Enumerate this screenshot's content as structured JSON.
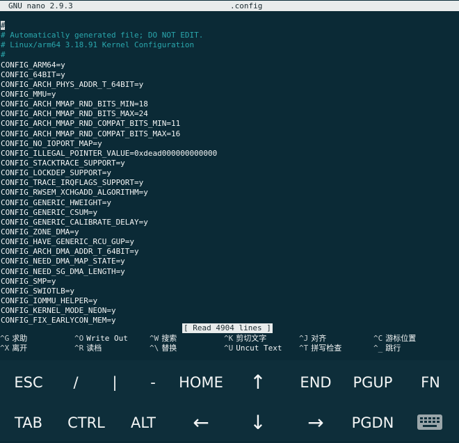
{
  "titlebar": {
    "version": "GNU nano 2.9.3",
    "filename": ".config"
  },
  "editor": {
    "cursor_char": "#",
    "lines": [
      "# Automatically generated file; DO NOT EDIT.",
      "# Linux/arm64 3.18.91 Kernel Configuration",
      "#",
      "CONFIG_ARM64=y",
      "CONFIG_64BIT=y",
      "CONFIG_ARCH_PHYS_ADDR_T_64BIT=y",
      "CONFIG_MMU=y",
      "CONFIG_ARCH_MMAP_RND_BITS_MIN=18",
      "CONFIG_ARCH_MMAP_RND_BITS_MAX=24",
      "CONFIG_ARCH_MMAP_RND_COMPAT_BITS_MIN=11",
      "CONFIG_ARCH_MMAP_RND_COMPAT_BITS_MAX=16",
      "CONFIG_NO_IOPORT_MAP=y",
      "CONFIG_ILLEGAL_POINTER_VALUE=0xdead000000000000",
      "CONFIG_STACKTRACE_SUPPORT=y",
      "CONFIG_LOCKDEP_SUPPORT=y",
      "CONFIG_TRACE_IRQFLAGS_SUPPORT=y",
      "CONFIG_RWSEM_XCHGADD_ALGORITHM=y",
      "CONFIG_GENERIC_HWEIGHT=y",
      "CONFIG_GENERIC_CSUM=y",
      "CONFIG_GENERIC_CALIBRATE_DELAY=y",
      "CONFIG_ZONE_DMA=y",
      "CONFIG_HAVE_GENERIC_RCU_GUP=y",
      "CONFIG_ARCH_DMA_ADDR_T_64BIT=y",
      "CONFIG_NEED_DMA_MAP_STATE=y",
      "CONFIG_NEED_SG_DMA_LENGTH=y",
      "CONFIG_SMP=y",
      "CONFIG_SWIOTLB=y",
      "CONFIG_IOMMU_HELPER=y",
      "CONFIG_KERNEL_MODE_NEON=y",
      "CONFIG_FIX_EARLYCON_MEM=y"
    ]
  },
  "status": "[ Read 4904 lines ]",
  "shortcuts": [
    {
      "key": "^G",
      "label": "求助"
    },
    {
      "key": "^O",
      "label": "Write Out"
    },
    {
      "key": "^W",
      "label": "搜索"
    },
    {
      "key": "^K",
      "label": "剪切文字"
    },
    {
      "key": "^J",
      "label": "对齐"
    },
    {
      "key": "^C",
      "label": "游标位置"
    },
    {
      "key": "^X",
      "label": "离开"
    },
    {
      "key": "^R",
      "label": "读档"
    },
    {
      "key": "^\\",
      "label": "替换"
    },
    {
      "key": "^U",
      "label": "Uncut Text"
    },
    {
      "key": "^T",
      "label": "拼写检查"
    },
    {
      "key": "^_",
      "label": "跳行"
    }
  ],
  "keys": {
    "row1": [
      "ESC",
      "/",
      "|",
      "-",
      "HOME",
      "↑",
      "END",
      "PGUP",
      "FN"
    ],
    "row2": [
      "TAB",
      "CTRL",
      "ALT",
      "←",
      "↓",
      "→",
      "PGDN"
    ]
  },
  "colors": {
    "background": "#0b2a36",
    "comment": "#2aa7ad",
    "bar": "#e9ecec"
  }
}
